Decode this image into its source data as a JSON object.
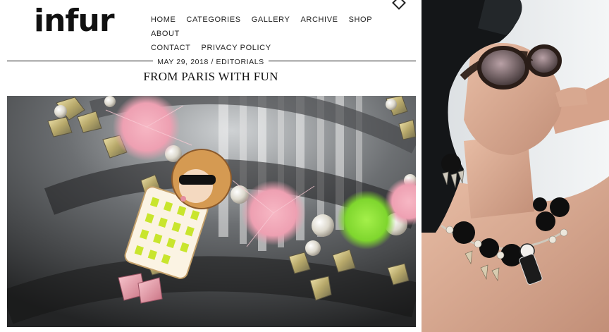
{
  "site": {
    "logo_text": "infur"
  },
  "nav": {
    "items": [
      {
        "label": "HOME"
      },
      {
        "label": "CATEGORIES"
      },
      {
        "label": "GALLERY"
      },
      {
        "label": "ARCHIVE"
      },
      {
        "label": "SHOP"
      },
      {
        "label": "ABOUT"
      },
      {
        "label": "CONTACT"
      },
      {
        "label": "PRIVACY POLICY"
      }
    ]
  },
  "post": {
    "date": "MAY 29, 2018",
    "separator": " / ",
    "category": "EDITORIALS",
    "title": "FROM PARIS WITH FUN"
  },
  "colors": {
    "text": "#111111",
    "pom_pink": "#f3a9b9",
    "pom_green": "#8ee63a",
    "background": "#ffffff"
  }
}
